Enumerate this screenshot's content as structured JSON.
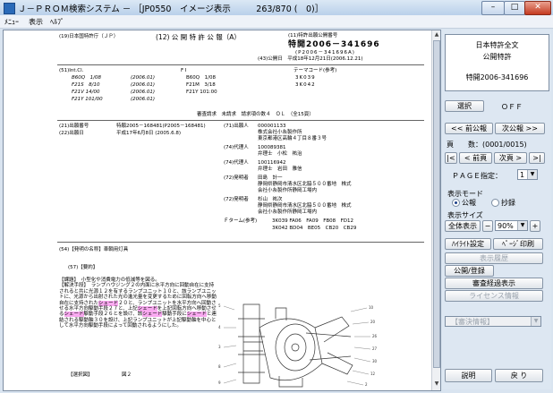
{
  "window": {
    "title": "Ｊ－ＰＲＯＭ検索システム － ［JP0550　イメージ表示　　　263/870 (　0)］",
    "min": "–",
    "max": "□",
    "close": "✕"
  },
  "menu": [
    "ﾒﾆｭｰ",
    "表示",
    "ﾍﾙﾌﾟ"
  ],
  "doc": {
    "h19": "(19)日本国特許庁（ＪＰ）",
    "h12": "(12) 公 開 特 許 公 報（A）",
    "h11": "(11)特許出願公開番号",
    "pubnum": "特開2006－341696",
    "pubnum_p": "(P2006－341696A)",
    "h43": "(43)公開日　平成18年12月21日(2006.12.21)",
    "intcl_hdr": "(51)Int.Cl.",
    "fi_hdr": "F I",
    "theme_hdr": "テーマコード(参考)",
    "ipc": [
      {
        "code": "B60Q　1/08",
        "date": "(2006.01)",
        "fi": "B60Q　1/08",
        "theme": "3K039"
      },
      {
        "code": "F21S　8/10",
        "date": "(2006.01)",
        "fi": "F21M　3/18",
        "theme": "3K042"
      },
      {
        "code": "F21V 14/00",
        "date": "(2006.01)",
        "fi": "F21Y 101:00",
        "theme": ""
      },
      {
        "code": "F21Y 101/00",
        "date": "(2006.01)",
        "fi": "",
        "theme": ""
      }
    ],
    "claims": "審査請求　未請求　請求項の数４　ＯＬ　（全15頁）",
    "f21_label": "(21)出願番号",
    "f21_val": "特願2005－168481(P2005－168481)",
    "f22_label": "(22)出願日",
    "f22_val": "平成17年6月8日 (2005.6.8)",
    "f71_label": "(71)出願人",
    "f71_val": [
      "000001133",
      "株式会社小糸製作所",
      "東京都港区高輪４丁目８番３号"
    ],
    "f74a_label": "(74)代理人",
    "f74a_val": [
      "100089381",
      "弁理士　小松　祐治"
    ],
    "f74b_label": "(74)代理人",
    "f74b_val": [
      "100116942",
      "弁理士　岩田　雅信"
    ],
    "f72a_label": "(72)発明者",
    "f72a_val": [
      "田島　計一",
      "静岡県静岡市清水区北脇５００番地　株式",
      "会社小糸製作所静岡工場内"
    ],
    "f72b_label": "(72)発明者",
    "f72b_val": [
      "杉山　祐次",
      "静岡県静岡市清水区北脇５００番地　株式",
      "会社小糸製作所静岡工場内"
    ],
    "fterm_label": "Ｆターム(参考)",
    "fterm_val": [
      "3K039 FA06　FA09　FB08　FD12",
      "3K042 BD04　BE05　CB20　CB29"
    ],
    "f54": "(54)【発明の名称】車輌用灯具",
    "f57": "(57)【要約】",
    "abstract": [
      {
        "t": "【課題】　小型化や消費電力の低減等を図る。"
      },
      {
        "t": "【解決手段】　ランプハウジング２の内面に水平方向に回動自在に支持されると共に光源１２を有するランプユニット１０と、該ランプユニットに、光源から出射された光の進光量を変更するために回転方向へ移動自在に支持された"
      },
      {
        "t": "シェード",
        "hl": true
      },
      {
        "t": "２０と、ランプユニットを水平方向へ回動させる水平方向駆動手段２７と、上記"
      },
      {
        "t": "シェード",
        "hl": true
      },
      {
        "t": "を上記回転方向へ移動させる"
      },
      {
        "t": "シェード",
        "hl": true
      },
      {
        "t": "駆動手段２６とを設け、該"
      },
      {
        "t": "シェード",
        "hl": true
      },
      {
        "t": "駆動手段に"
      },
      {
        "t": "シェード",
        "hl": true
      },
      {
        "t": "と連結される駆動軸３０を設け、上記ランプユニットが上記駆動軸を中心として水平方向駆動手段によって回動されるようにした。"
      }
    ],
    "fig_sel": "【選択図】",
    "fig_no": "図２"
  },
  "side": {
    "info": [
      "日本特許全文",
      "公開特許",
      "特開2006-341696"
    ],
    "select_btn": "選択",
    "select_state": "ＯＦＦ",
    "prev_pub": "<< 前公報",
    "next_pub": "次公報 >>",
    "page_label": "頁　　数：(0001/0015)",
    "first": "|<",
    "prev": "< 前頁",
    "next": "次頁 >",
    "last": ">|",
    "page_spec": "ＰＡＧＥ指定：",
    "page_value": "1",
    "mode_label": "表示モード",
    "mode_pub": "公報",
    "mode_excerpt": "抄録",
    "size_label": "表示サイズ",
    "full_view": "全体表示",
    "minus": "−",
    "zoom": "90%",
    "plus": "+",
    "highlight": "ﾊｲﾗｲﾄ設定",
    "print": "ﾍﾟｰｼﾞ印刷",
    "history": "表示履歴",
    "publish": "公開/登録",
    "exam": "審査経過表示",
    "license": "ライセンス情報",
    "exam_info": "【審決情報】",
    "explain": "説明",
    "back": "戻 り"
  }
}
